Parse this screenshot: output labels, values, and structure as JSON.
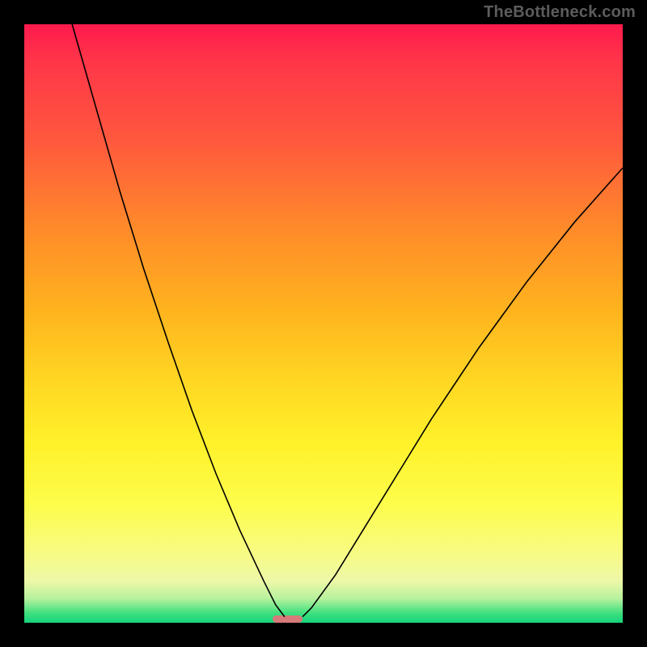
{
  "watermark": "TheBottleneck.com",
  "chart_data": {
    "type": "line",
    "title": "",
    "xlabel": "",
    "ylabel": "",
    "xlim": [
      0,
      100
    ],
    "ylim": [
      0,
      100
    ],
    "grid": false,
    "legend": false,
    "colors": {
      "frame": "#000000",
      "curve": "#000000",
      "marker": "#d77a7a",
      "gradient_top": "#ff1a4d",
      "gradient_mid": "#ffd823",
      "gradient_bottom": "#16d47d"
    },
    "minimum": {
      "x": 44,
      "width": 5,
      "y": 0,
      "height": 1.2
    },
    "series": [
      {
        "name": "left-branch",
        "x": [
          8,
          12,
          16,
          20,
          24,
          28,
          32,
          36,
          40,
          42,
          43.5
        ],
        "values": [
          100,
          86,
          72,
          59,
          47,
          35.5,
          25,
          15.5,
          7,
          3,
          1
        ]
      },
      {
        "name": "right-branch",
        "x": [
          46.5,
          48,
          52,
          56,
          60,
          64,
          68,
          72,
          76,
          80,
          84,
          88,
          92,
          96,
          100
        ],
        "values": [
          1,
          2.5,
          8,
          14.5,
          21,
          27.5,
          34,
          40,
          46,
          51.5,
          57,
          62,
          67,
          71.5,
          76
        ]
      }
    ],
    "annotations": []
  }
}
